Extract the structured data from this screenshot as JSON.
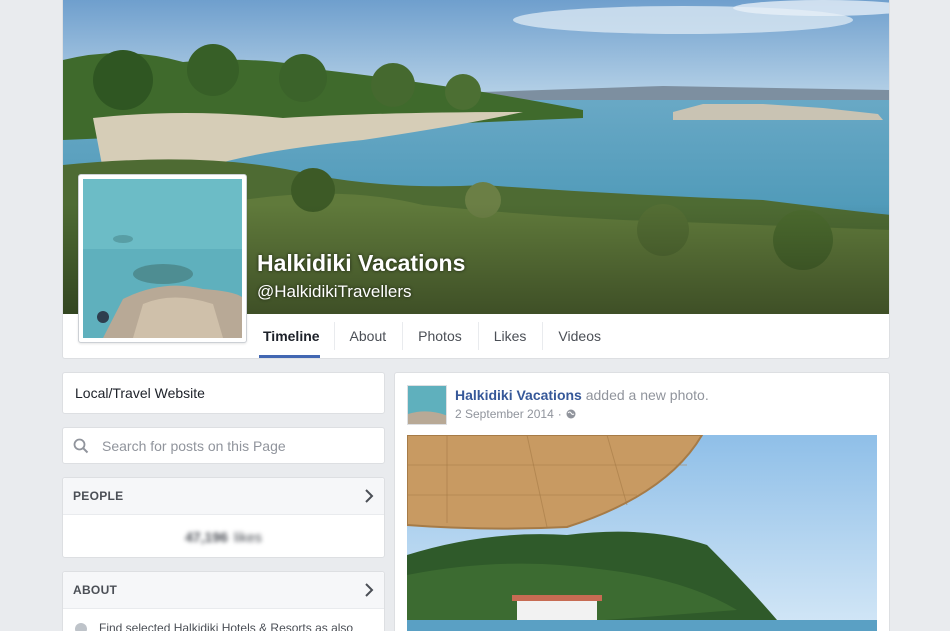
{
  "page": {
    "name": "Halkidiki Vacations",
    "handle": "@HalkidikiTravellers",
    "category": "Local/Travel Website"
  },
  "tabs": [
    {
      "label": "Timeline",
      "active": true
    },
    {
      "label": "About",
      "active": false
    },
    {
      "label": "Photos",
      "active": false
    },
    {
      "label": "Likes",
      "active": false
    },
    {
      "label": "Videos",
      "active": false
    }
  ],
  "search": {
    "placeholder": "Search for posts on this Page"
  },
  "people": {
    "header": "PEOPLE",
    "likes_count": "47,196",
    "likes_label": "likes"
  },
  "about": {
    "header": "ABOUT",
    "description": "Find selected Halkidiki Hotels & Resorts as also"
  },
  "post": {
    "author": "Halkidiki Vacations",
    "action": "added a new photo.",
    "date": "2 September 2014",
    "separator": "·"
  },
  "colors": {
    "accent": "#4267b2",
    "link": "#365899",
    "background": "#e9ebee"
  },
  "icons": {
    "search": "search-icon",
    "chevron": "chevron-right-icon",
    "globe": "globe-icon"
  }
}
